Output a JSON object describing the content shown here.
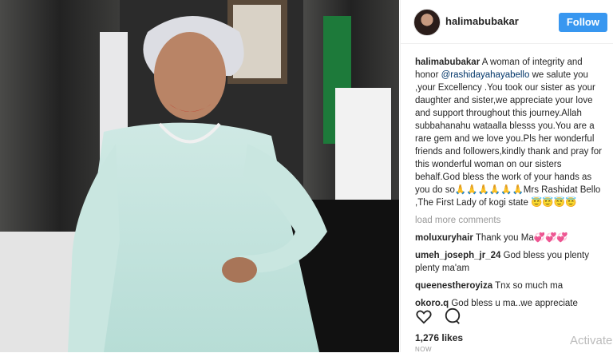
{
  "post": {
    "username": "halimabubakar",
    "follow_label": "Follow",
    "caption_user": "halimabubakar",
    "caption_part1": " A woman of integrity and honor ",
    "caption_mention": "@rashidayahayabello",
    "caption_part2": " we salute you ,your Excellency .You took our sister as your daughter and sister,we appreciate your love and support throughout this journey.Allah subbahanahu wataalla blesss you.You are a rare gem and we love you.Pls her wonderful friends and followers,kindly thank and pray for this wonderful woman on our sisters behalf.God bless the work of your hands as you do so🙏🙏🙏🙏🙏🙏Mrs Rashidat Bello ,The First Lady of kogi state 😇😇😇😇",
    "load_more": "load more comments",
    "comments": [
      {
        "user": "moluxuryhair",
        "text": " Thank you Ma💞💞💞"
      },
      {
        "user": "umeh_joseph_jr_24",
        "text": " God bless you plenty plenty ma'am"
      },
      {
        "user": "queenestheroyiza",
        "text": " Tnx so much ma"
      },
      {
        "user": "okoro.q",
        "text": " God bless u ma..we appreciate"
      }
    ],
    "likes": "1,276 likes",
    "date": "NOW"
  },
  "icons": {
    "like": "heart-icon",
    "comment": "comment-bubble-icon"
  },
  "watermark": "Activate",
  "colors": {
    "follow": "#3897f0",
    "mention": "#003569",
    "muted": "#999999"
  }
}
